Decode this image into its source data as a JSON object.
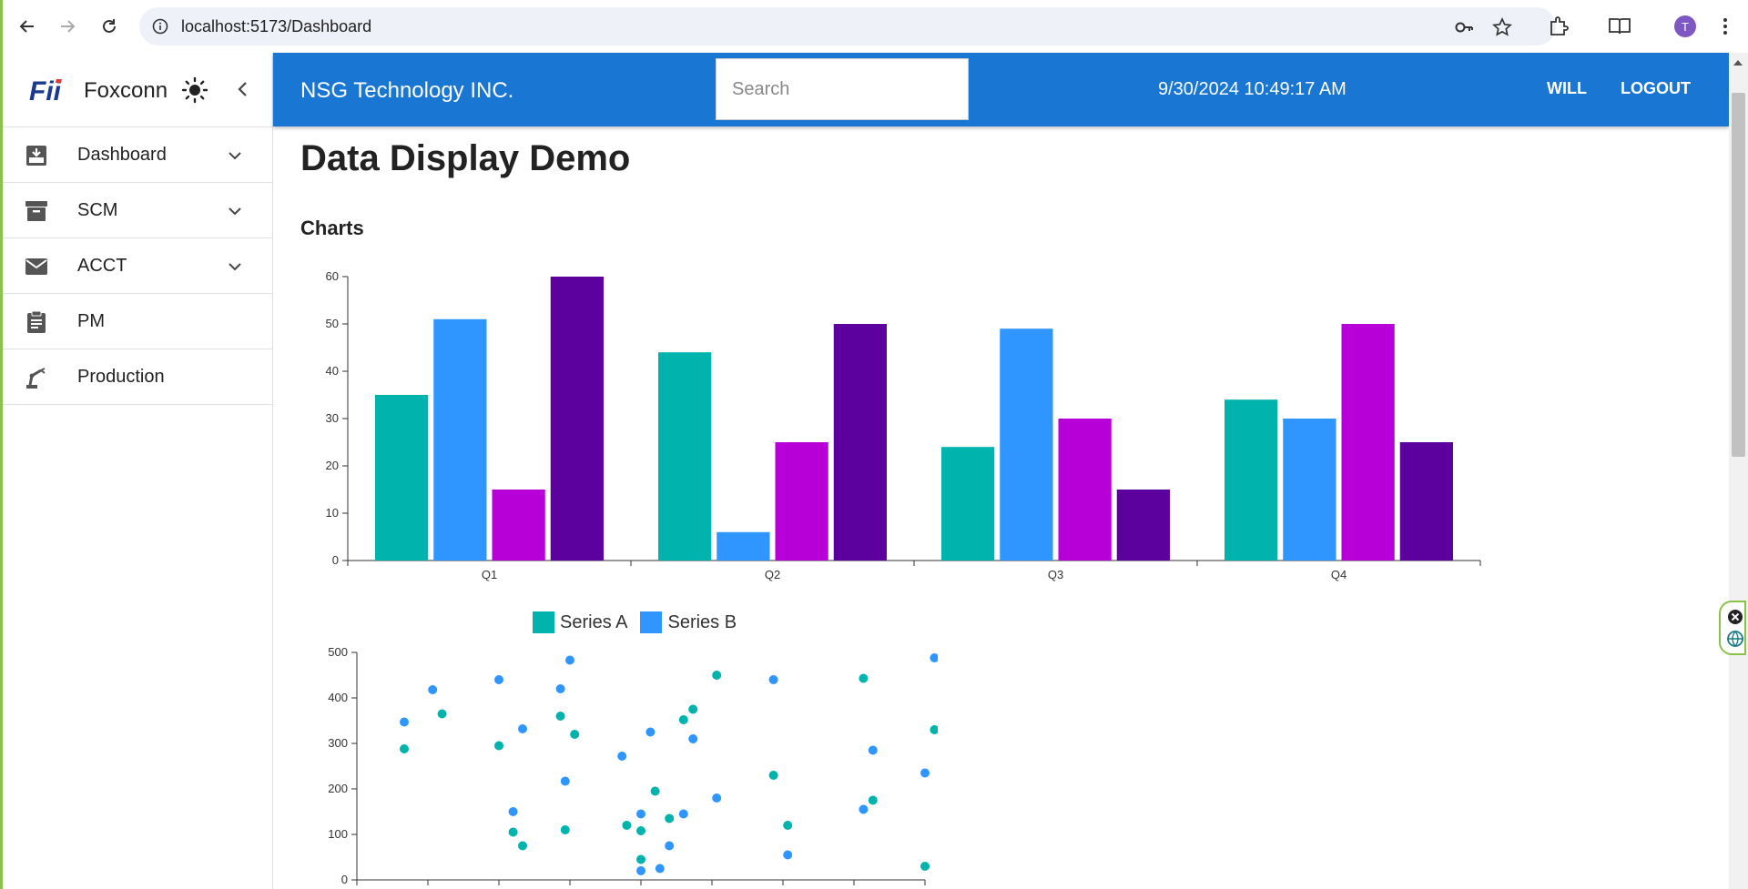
{
  "browser": {
    "url": "localhost:5173/Dashboard",
    "profile_initial": "T"
  },
  "sidebar": {
    "brand_logo_text": "Fii",
    "brand_name": "Foxconn",
    "items": [
      {
        "label": "Dashboard",
        "icon": "inbox-download-icon",
        "expandable": true
      },
      {
        "label": "SCM",
        "icon": "archive-icon",
        "expandable": true
      },
      {
        "label": "ACCT",
        "icon": "mail-icon",
        "expandable": true
      },
      {
        "label": "PM",
        "icon": "clipboard-icon",
        "expandable": false
      },
      {
        "label": "Production",
        "icon": "robot-arm-icon",
        "expandable": false
      }
    ]
  },
  "header": {
    "title": "NSG Technology INC.",
    "search_placeholder": "Search",
    "datetime": "9/30/2024 10:49:17 AM",
    "user_label": "WILL",
    "logout_label": "LOGOUT",
    "color": "#1976d2"
  },
  "main": {
    "page_title": "Data Display Demo",
    "section_title": "Charts"
  },
  "chart_data": [
    {
      "type": "bar",
      "categories": [
        "Q1",
        "Q2",
        "Q3",
        "Q4"
      ],
      "series": [
        {
          "values": [
            35,
            44,
            24,
            34
          ],
          "color": "#00b3ad"
        },
        {
          "values": [
            51,
            6,
            49,
            30
          ],
          "color": "#2f96ff"
        },
        {
          "values": [
            15,
            25,
            30,
            50
          ],
          "color": "#b700d8"
        },
        {
          "values": [
            60,
            50,
            15,
            25
          ],
          "color": "#5c009e"
        }
      ],
      "ylim": [
        0,
        60
      ],
      "yticks": [
        0,
        10,
        20,
        30,
        40,
        50,
        60
      ],
      "legend": "none",
      "grid": false
    },
    {
      "type": "scatter",
      "series": [
        {
          "name": "Series A",
          "color": "#00b3ad",
          "points": [
            [
              1,
              288
            ],
            [
              1.8,
              365
            ],
            [
              3,
              295
            ],
            [
              3.3,
              105
            ],
            [
              3.5,
              75
            ],
            [
              4.3,
              360
            ],
            [
              4.4,
              110
            ],
            [
              4.6,
              320
            ],
            [
              5.7,
              120
            ],
            [
              6,
              45
            ],
            [
              6,
              108
            ],
            [
              6.3,
              195
            ],
            [
              6.6,
              135
            ],
            [
              6.9,
              352
            ],
            [
              7.1,
              375
            ],
            [
              7.6,
              450
            ],
            [
              8.8,
              230
            ],
            [
              9.1,
              120
            ],
            [
              10.7,
              443
            ],
            [
              10.9,
              175
            ],
            [
              12,
              30
            ],
            [
              12.2,
              330
            ]
          ]
        },
        {
          "name": "Series B",
          "color": "#2f96ff",
          "points": [
            [
              1,
              347
            ],
            [
              1.6,
              418
            ],
            [
              3,
              440
            ],
            [
              3.3,
              150
            ],
            [
              3.5,
              332
            ],
            [
              4.3,
              420
            ],
            [
              4.4,
              217
            ],
            [
              4.5,
              483
            ],
            [
              5.6,
              272
            ],
            [
              6,
              145
            ],
            [
              6,
              20
            ],
            [
              6.2,
              325
            ],
            [
              6.4,
              25
            ],
            [
              6.6,
              75
            ],
            [
              6.9,
              145
            ],
            [
              7.1,
              310
            ],
            [
              7.6,
              180
            ],
            [
              8.8,
              440
            ],
            [
              9.1,
              55
            ],
            [
              10.7,
              155
            ],
            [
              10.9,
              285
            ],
            [
              12,
              235
            ],
            [
              12.2,
              488
            ]
          ]
        }
      ],
      "ylim": [
        0,
        500
      ],
      "yticks": [
        0,
        100,
        200,
        300,
        400,
        500
      ],
      "xlim": [
        0,
        12
      ],
      "legend": "top"
    }
  ]
}
